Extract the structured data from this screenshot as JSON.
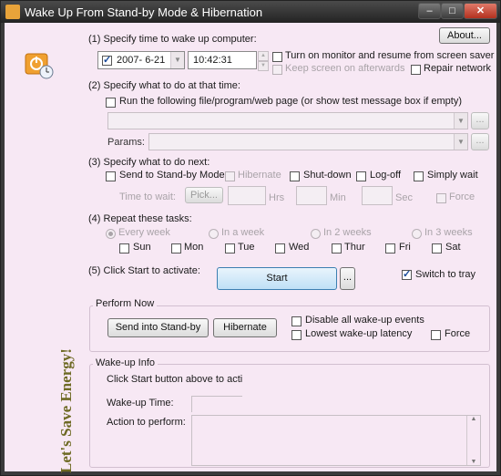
{
  "window": {
    "title": "Wake Up From Stand-by Mode & Hibernation",
    "min_glyph": "–",
    "max_glyph": "□",
    "close_glyph": "✕"
  },
  "about_label": "About...",
  "step1": {
    "label": "(1) Specify time to wake up computer:",
    "date": "2007-  6-21",
    "time": "10:42:31",
    "turn_on_monitor": "Turn on monitor and resume from screen saver",
    "keep_screen_on": "Keep screen on afterwards",
    "repair_network": "Repair network"
  },
  "step2": {
    "label": "(2) Specify what to do at that time:",
    "run_file": "Run the following file/program/web page (or show test message box if empty)",
    "params_label": "Params:",
    "browse": "..."
  },
  "step3": {
    "label": "(3) Specify what to do next:",
    "standby": "Send to Stand-by Mode",
    "hibernate": "Hibernate",
    "shutdown": "Shut-down",
    "logoff": "Log-off",
    "simply_wait": "Simply wait",
    "time_to_wait": "Time to wait:",
    "pick": "Pick...",
    "hrs": "Hrs",
    "min": "Min",
    "sec": "Sec",
    "force": "Force"
  },
  "step4": {
    "label": "(4) Repeat these tasks:",
    "every_week": "Every week",
    "in_a_week": "In a week",
    "in_2_weeks": "In 2 weeks",
    "in_3_weeks": "In 3 weeks",
    "days": [
      "Sun",
      "Mon",
      "Tue",
      "Wed",
      "Thur",
      "Fri",
      "Sat"
    ]
  },
  "step5": {
    "label": "(5) Click Start to activate:",
    "start": "Start",
    "more": "...",
    "switch_to_tray": "Switch to tray"
  },
  "perform_now": {
    "title": "Perform Now",
    "standby_btn": "Send into Stand-by",
    "hibernate_btn": "Hibernate",
    "disable_events": "Disable all wake-up events",
    "lowest_latency": "Lowest wake-up latency",
    "force": "Force"
  },
  "wakeup_info": {
    "title": "Wake-up Info",
    "hint": "Click Start button above to acti",
    "wakeup_time_label": "Wake-up Time:",
    "action_label": "Action to perform:"
  },
  "slogan": "Let's Save Energy!"
}
